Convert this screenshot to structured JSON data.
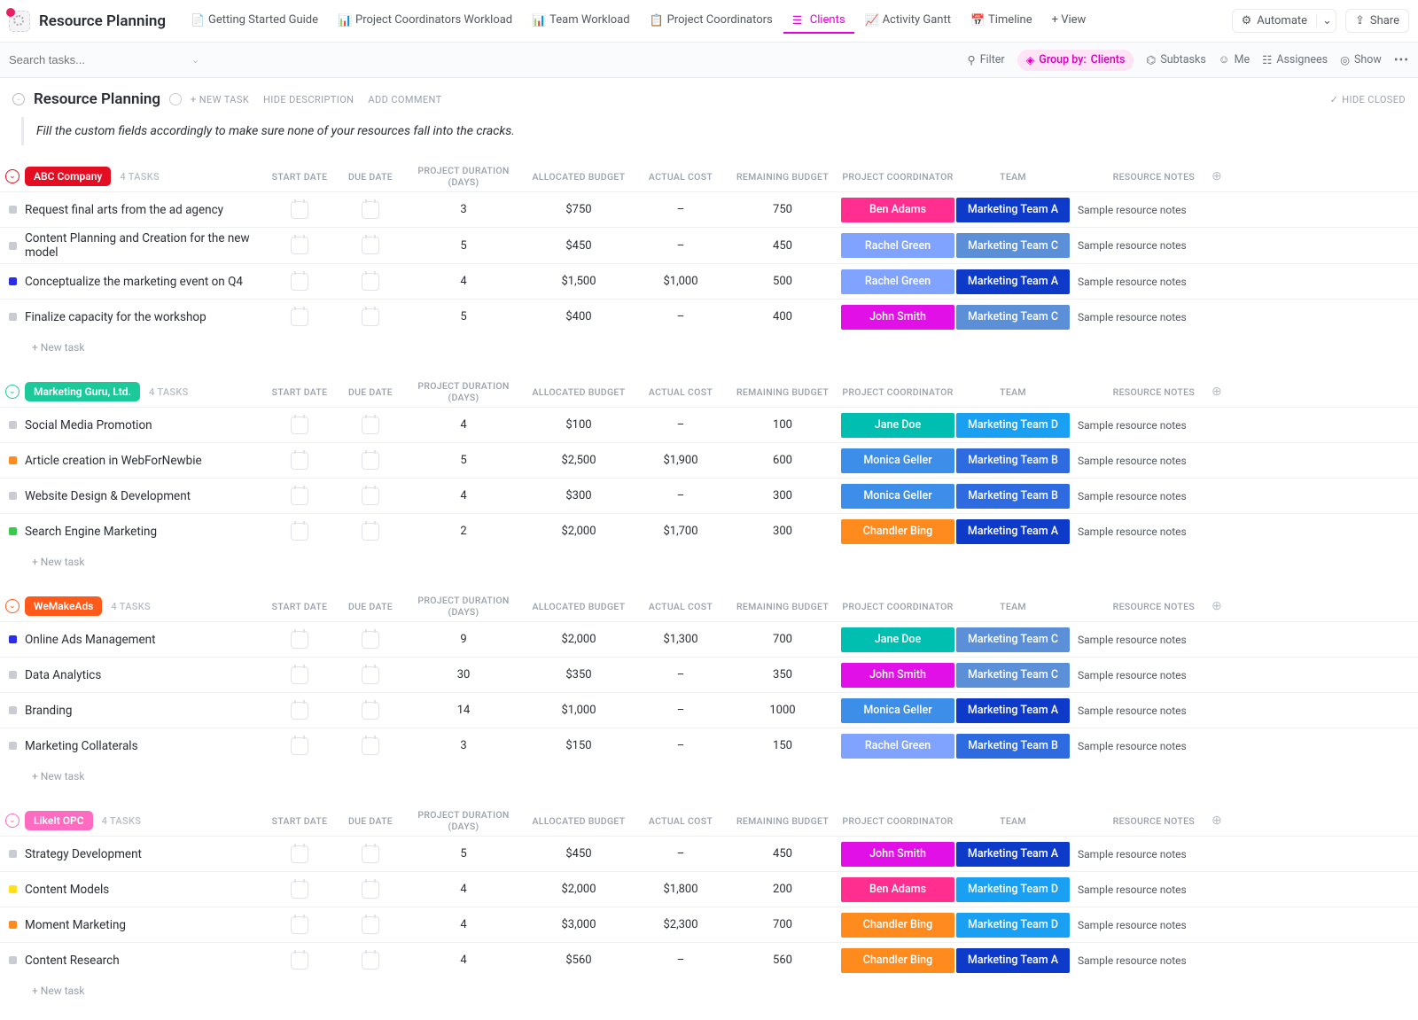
{
  "header": {
    "title": "Resource Planning",
    "tabs": [
      {
        "label": "Getting Started Guide"
      },
      {
        "label": "Project Coordinators Workload"
      },
      {
        "label": "Team Workload"
      },
      {
        "label": "Project Coordinators"
      },
      {
        "label": "Clients",
        "active": true
      },
      {
        "label": "Activity Gantt"
      },
      {
        "label": "Timeline"
      },
      {
        "label": "+ View"
      }
    ],
    "automate": "Automate",
    "share": "Share"
  },
  "filterbar": {
    "search_placeholder": "Search tasks...",
    "filter": "Filter",
    "group_by_prefix": "Group by:",
    "group_by_value": "Clients",
    "subtasks": "Subtasks",
    "me": "Me",
    "assignees": "Assignees",
    "show": "Show"
  },
  "subheader": {
    "title": "Resource Planning",
    "new_task": "+ NEW TASK",
    "hide_desc": "HIDE DESCRIPTION",
    "add_comment": "ADD COMMENT",
    "hide_closed": "HIDE CLOSED"
  },
  "description": "Fill the custom fields accordingly to make sure none of your resources fall into the cracks.",
  "columns": {
    "start": "START DATE",
    "due": "DUE DATE",
    "duration": "PROJECT DURATION (DAYS)",
    "budget": "ALLOCATED BUDGET",
    "actual": "ACTUAL COST",
    "remaining": "REMAINING BUDGET",
    "coordinator": "PROJECT COORDINATOR",
    "team": "TEAM",
    "notes": "RESOURCE NOTES"
  },
  "labels": {
    "tasks_suffix": "TASKS",
    "new_task_row": "+ New task"
  },
  "coordinators": {
    "Ben Adams": "#ff2e8f",
    "Rachel Green": "#7fa3ff",
    "John Smith": "#e010e6",
    "Jane Doe": "#00bfb0",
    "Monica Geller": "#3d8ee8",
    "Chandler Bing": "#ff8a1e"
  },
  "teams": {
    "Marketing Team A": "#0d3ac9",
    "Marketing Team B": "#2f6be0",
    "Marketing Team C": "#5b8fd8",
    "Marketing Team D": "#1aa0f2"
  },
  "groups": [
    {
      "name": "ABC Company",
      "pill_color": "#e40d22",
      "toggle_color": "#e40d22",
      "count": 4,
      "tasks": [
        {
          "bullet": "#c9ccd3",
          "name": "Request final arts from the ad agency",
          "duration": "3",
          "budget": "$750",
          "actual": "–",
          "remaining": "750",
          "coord": "Ben Adams",
          "team": "Marketing Team A",
          "notes": "Sample resource notes"
        },
        {
          "bullet": "#c9ccd3",
          "name": "Content Planning and Creation for the new model",
          "duration": "5",
          "budget": "$450",
          "actual": "–",
          "remaining": "450",
          "coord": "Rachel Green",
          "team": "Marketing Team C",
          "notes": "Sample resource notes"
        },
        {
          "bullet": "#2a2ee8",
          "name": "Conceptualize the marketing event on Q4",
          "duration": "4",
          "budget": "$1,500",
          "actual": "$1,000",
          "remaining": "500",
          "coord": "Rachel Green",
          "team": "Marketing Team A",
          "notes": "Sample resource notes"
        },
        {
          "bullet": "#c9ccd3",
          "name": "Finalize capacity for the workshop",
          "duration": "5",
          "budget": "$400",
          "actual": "–",
          "remaining": "400",
          "coord": "John Smith",
          "team": "Marketing Team C",
          "notes": "Sample resource notes"
        }
      ]
    },
    {
      "name": "Marketing Guru, Ltd.",
      "pill_color": "#1cc99a",
      "toggle_color": "#1cc99a",
      "count": 4,
      "tasks": [
        {
          "bullet": "#c9ccd3",
          "name": "Social Media Promotion",
          "duration": "4",
          "budget": "$100",
          "actual": "–",
          "remaining": "100",
          "coord": "Jane Doe",
          "team": "Marketing Team D",
          "notes": "Sample resource notes"
        },
        {
          "bullet": "#ff8a1e",
          "name": "Article creation in WebForNewbie",
          "duration": "5",
          "budget": "$2,500",
          "actual": "$1,900",
          "remaining": "600",
          "coord": "Monica Geller",
          "team": "Marketing Team B",
          "notes": "Sample resource notes"
        },
        {
          "bullet": "#c9ccd3",
          "name": "Website Design & Development",
          "duration": "4",
          "budget": "$300",
          "actual": "–",
          "remaining": "300",
          "coord": "Monica Geller",
          "team": "Marketing Team B",
          "notes": "Sample resource notes"
        },
        {
          "bullet": "#3ac94e",
          "name": "Search Engine Marketing",
          "duration": "2",
          "budget": "$2,000",
          "actual": "$1,700",
          "remaining": "300",
          "coord": "Chandler Bing",
          "team": "Marketing Team A",
          "notes": "Sample resource notes"
        }
      ]
    },
    {
      "name": "WeMakeAds",
      "pill_color": "#ff5a1a",
      "toggle_color": "#ff5a1a",
      "count": 4,
      "tasks": [
        {
          "bullet": "#2a2ee8",
          "name": "Online Ads Management",
          "duration": "9",
          "budget": "$2,000",
          "actual": "$1,300",
          "remaining": "700",
          "coord": "Jane Doe",
          "team": "Marketing Team C",
          "notes": "Sample resource notes"
        },
        {
          "bullet": "#c9ccd3",
          "name": "Data Analytics",
          "duration": "30",
          "budget": "$350",
          "actual": "–",
          "remaining": "350",
          "coord": "John Smith",
          "team": "Marketing Team C",
          "notes": "Sample resource notes"
        },
        {
          "bullet": "#c9ccd3",
          "name": "Branding",
          "duration": "14",
          "budget": "$1,000",
          "actual": "–",
          "remaining": "1000",
          "coord": "Monica Geller",
          "team": "Marketing Team A",
          "notes": "Sample resource notes"
        },
        {
          "bullet": "#c9ccd3",
          "name": "Marketing Collaterals",
          "duration": "3",
          "budget": "$150",
          "actual": "–",
          "remaining": "150",
          "coord": "Rachel Green",
          "team": "Marketing Team B",
          "notes": "Sample resource notes"
        }
      ]
    },
    {
      "name": "LikeIt OPC",
      "pill_color": "#ff6bc1",
      "toggle_color": "#ff6bc1",
      "count": 4,
      "tasks": [
        {
          "bullet": "#c9ccd3",
          "name": "Strategy Development",
          "duration": "5",
          "budget": "$450",
          "actual": "–",
          "remaining": "450",
          "coord": "John Smith",
          "team": "Marketing Team A",
          "notes": "Sample resource notes"
        },
        {
          "bullet": "#ffe01a",
          "name": "Content Models",
          "duration": "4",
          "budget": "$2,000",
          "actual": "$1,800",
          "remaining": "200",
          "coord": "Ben Adams",
          "team": "Marketing Team D",
          "notes": "Sample resource notes"
        },
        {
          "bullet": "#ff8a1e",
          "name": "Moment Marketing",
          "duration": "4",
          "budget": "$3,000",
          "actual": "$2,300",
          "remaining": "700",
          "coord": "Chandler Bing",
          "team": "Marketing Team D",
          "notes": "Sample resource notes"
        },
        {
          "bullet": "#c9ccd3",
          "name": "Content Research",
          "duration": "4",
          "budget": "$560",
          "actual": "–",
          "remaining": "560",
          "coord": "Chandler Bing",
          "team": "Marketing Team A",
          "notes": "Sample resource notes"
        }
      ]
    }
  ]
}
